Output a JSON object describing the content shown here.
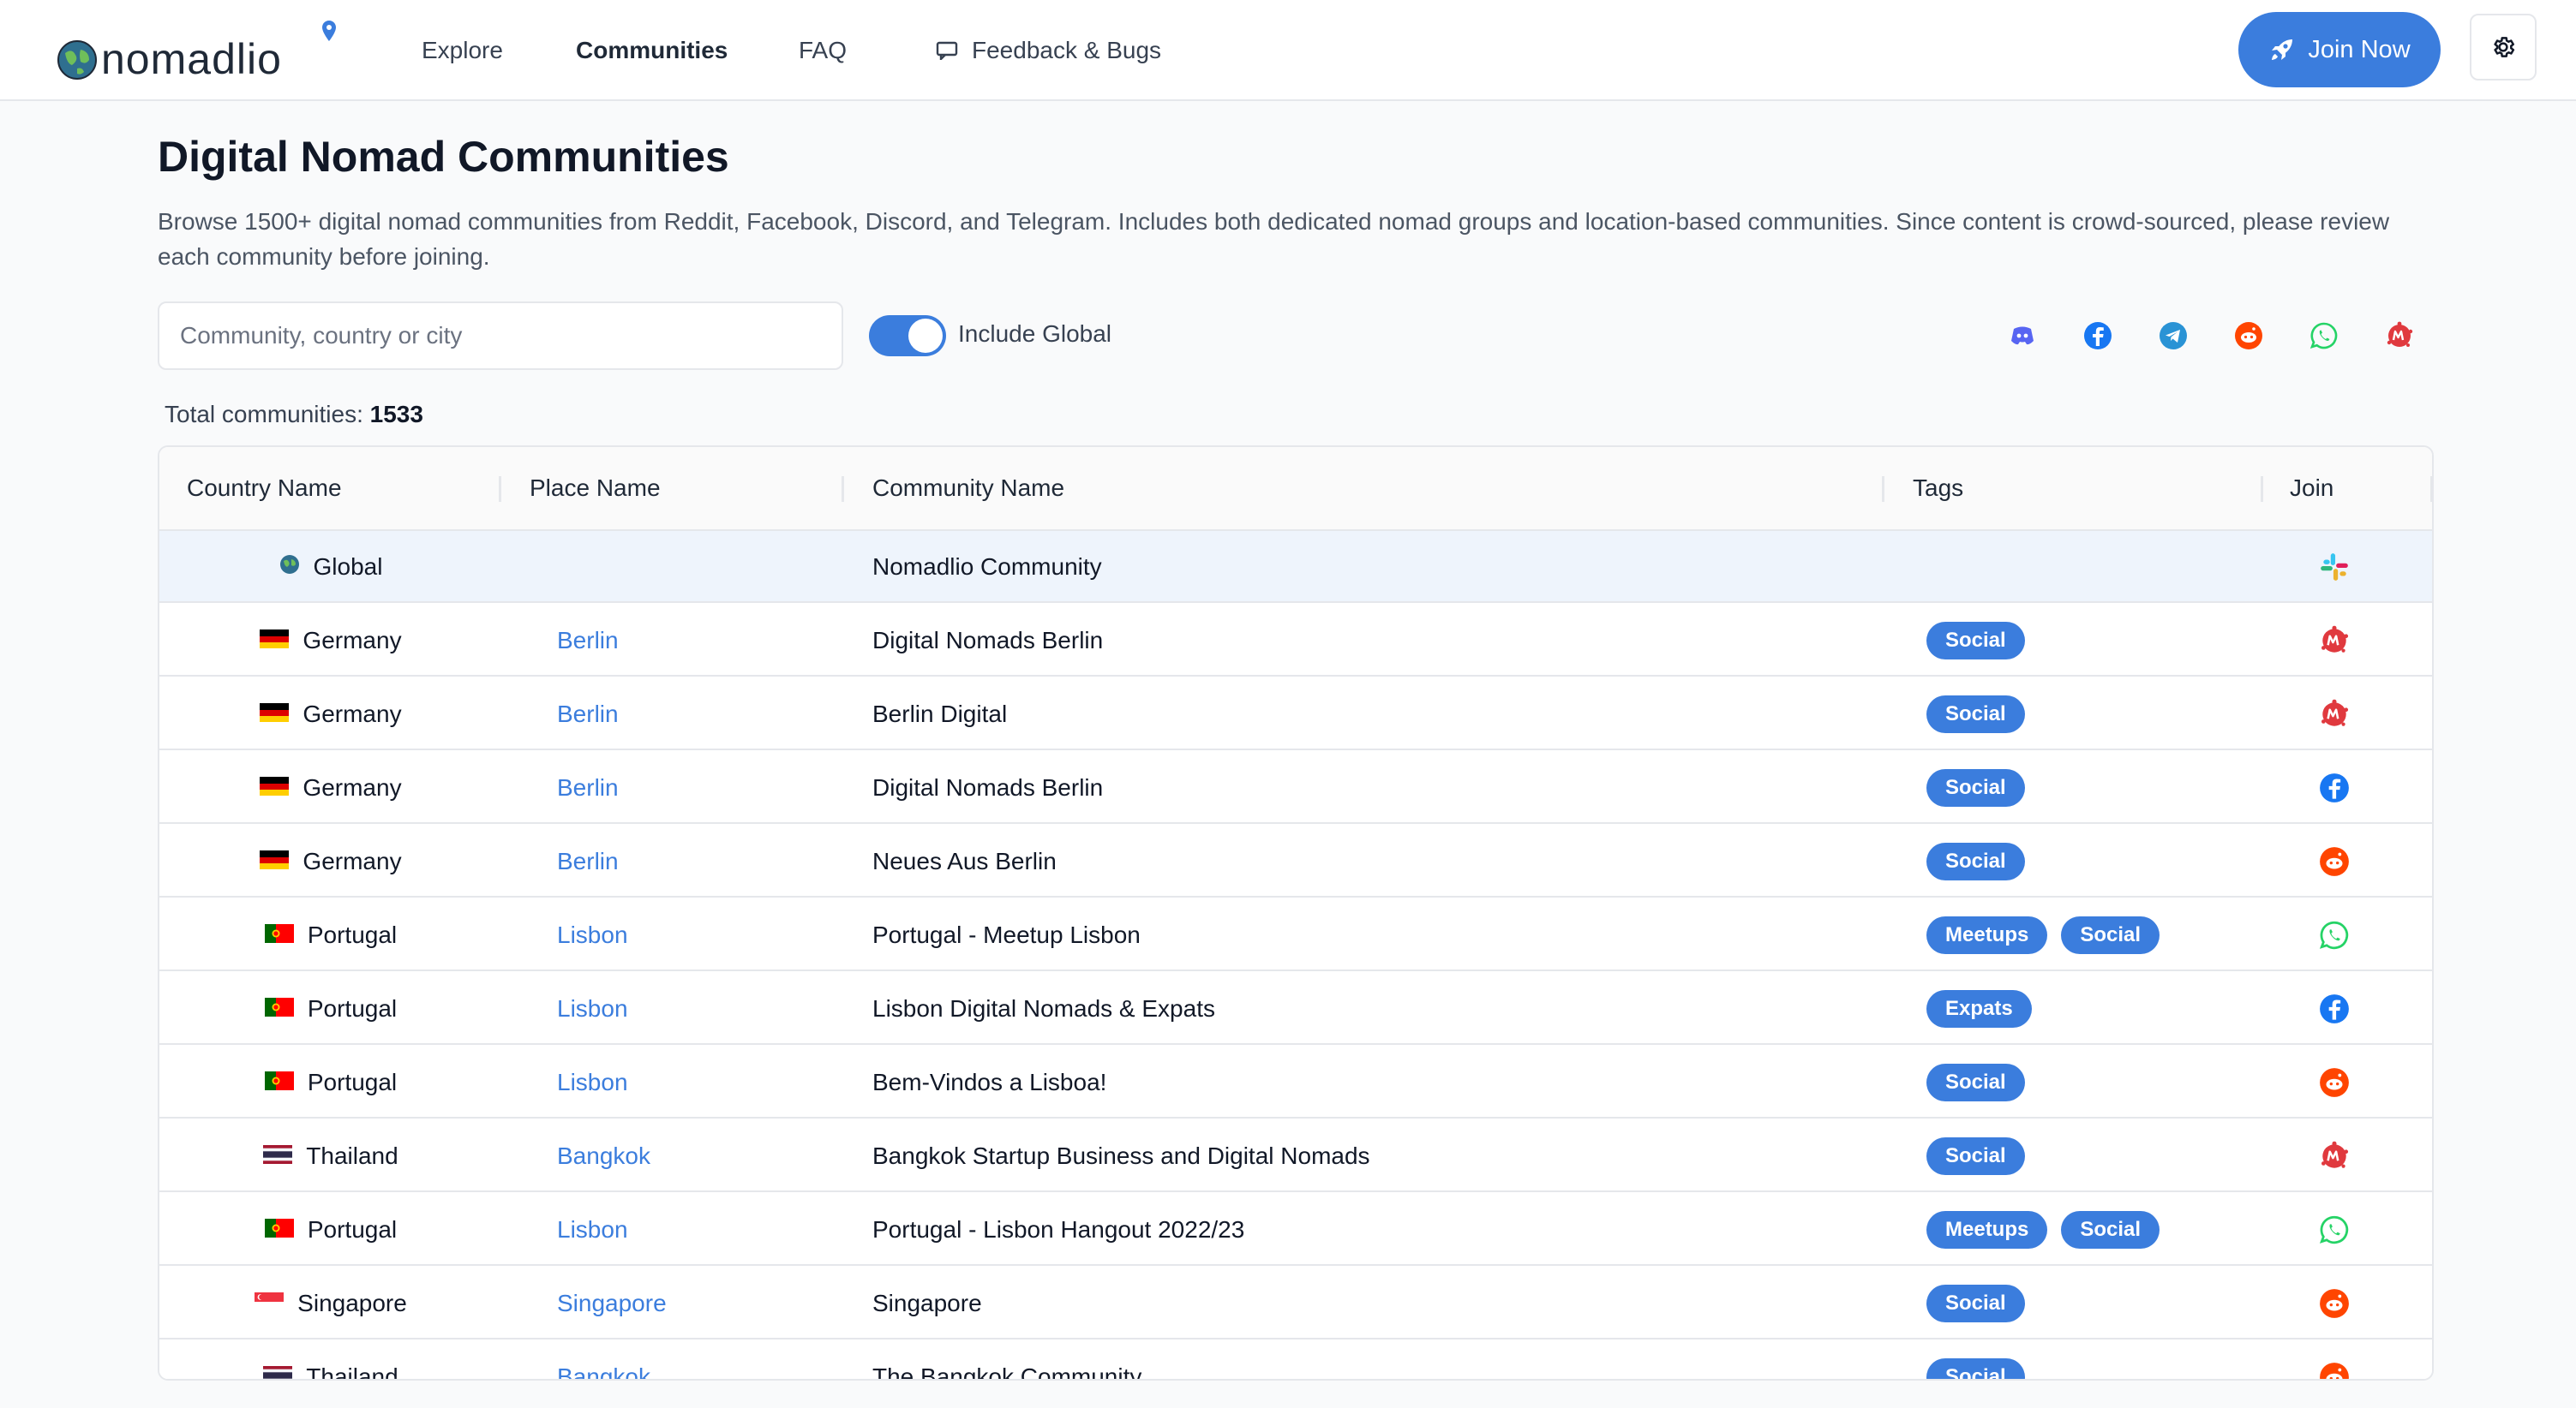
{
  "header": {
    "logo_text": "nomadlio",
    "nav": [
      "Explore",
      "Communities",
      "FAQ",
      "Feedback & Bugs"
    ],
    "join_label": "Join Now",
    "accent": "#3b7ddd"
  },
  "page": {
    "title": "Digital Nomad Communities",
    "description": "Browse 1500+ digital nomad communities from Reddit, Facebook, Discord, and Telegram. Includes both dedicated nomad groups and location-based communities. Since content is crowd-sourced, please review each community before joining.",
    "search_placeholder": "Community, country or city",
    "toggle_label": "Include Global",
    "include_global": true,
    "total_label": "Total communities:",
    "total_value": "1533",
    "platform_filters": [
      "discord-icon",
      "facebook-icon",
      "telegram-icon",
      "reddit-icon",
      "whatsapp-icon",
      "meetup-icon"
    ]
  },
  "table": {
    "columns": [
      "Country Name",
      "Place Name",
      "Community Name",
      "Tags",
      "Join"
    ],
    "rows": [
      {
        "country": "Global",
        "flag": "globe",
        "place": "",
        "community": "Nomadlio Community",
        "tags": [],
        "join": "slack-icon"
      },
      {
        "country": "Germany",
        "flag": "de",
        "place": "Berlin",
        "community": "Digital Nomads Berlin",
        "tags": [
          "Social"
        ],
        "join": "meetup-icon"
      },
      {
        "country": "Germany",
        "flag": "de",
        "place": "Berlin",
        "community": "Berlin Digital",
        "tags": [
          "Social"
        ],
        "join": "meetup-icon"
      },
      {
        "country": "Germany",
        "flag": "de",
        "place": "Berlin",
        "community": "Digital Nomads Berlin",
        "tags": [
          "Social"
        ],
        "join": "facebook-icon"
      },
      {
        "country": "Germany",
        "flag": "de",
        "place": "Berlin",
        "community": "Neues Aus Berlin",
        "tags": [
          "Social"
        ],
        "join": "reddit-icon"
      },
      {
        "country": "Portugal",
        "flag": "pt",
        "place": "Lisbon",
        "community": "Portugal - Meetup Lisbon",
        "tags": [
          "Meetups",
          "Social"
        ],
        "join": "whatsapp-icon"
      },
      {
        "country": "Portugal",
        "flag": "pt",
        "place": "Lisbon",
        "community": "Lisbon Digital Nomads & Expats",
        "tags": [
          "Expats"
        ],
        "join": "facebook-icon"
      },
      {
        "country": "Portugal",
        "flag": "pt",
        "place": "Lisbon",
        "community": "Bem-Vindos a Lisboa!",
        "tags": [
          "Social"
        ],
        "join": "reddit-icon"
      },
      {
        "country": "Thailand",
        "flag": "th",
        "place": "Bangkok",
        "community": "Bangkok Startup Business and Digital Nomads",
        "tags": [
          "Social"
        ],
        "join": "meetup-icon"
      },
      {
        "country": "Portugal",
        "flag": "pt",
        "place": "Lisbon",
        "community": "Portugal - Lisbon Hangout 2022/23",
        "tags": [
          "Meetups",
          "Social"
        ],
        "join": "whatsapp-icon"
      },
      {
        "country": "Singapore",
        "flag": "sg",
        "place": "Singapore",
        "community": "Singapore",
        "tags": [
          "Social"
        ],
        "join": "reddit-icon"
      },
      {
        "country": "Thailand",
        "flag": "th",
        "place": "Bangkok",
        "community": "The Bangkok Community",
        "tags": [
          "Social"
        ],
        "join": "reddit-icon"
      }
    ]
  }
}
